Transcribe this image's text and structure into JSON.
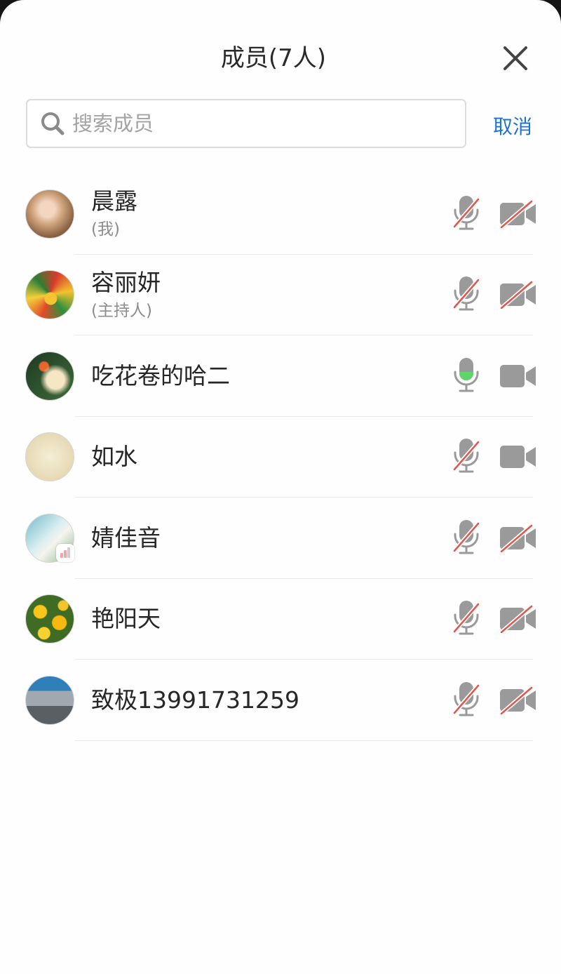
{
  "header": {
    "title": "成员(7人)",
    "close_icon": "close-icon"
  },
  "search": {
    "icon": "search-icon",
    "placeholder": "搜索成员",
    "value": "",
    "cancel_label": "取消"
  },
  "members": [
    {
      "name": "晨露",
      "role": "(我)",
      "mic": "muted",
      "video": "off"
    },
    {
      "name": "容丽妍",
      "role": "(主持人)",
      "mic": "muted",
      "video": "off"
    },
    {
      "name": "吃花卷的哈二",
      "mic": "active",
      "video": "on"
    },
    {
      "name": "如水",
      "mic": "muted",
      "video": "on"
    },
    {
      "name": "婧佳音",
      "mic": "muted",
      "video": "off",
      "status_icon": "signal-strength-icon"
    },
    {
      "name": "艳阳天",
      "mic": "muted",
      "video": "off"
    },
    {
      "name": "致极13991731259",
      "mic": "muted",
      "video": "off"
    }
  ],
  "icons": {
    "mic": "microphone-icon",
    "camera": "camera-icon",
    "muted_overlay": "red-slash"
  },
  "colors": {
    "accent": "#1f73cc",
    "muted_slash": "#e0574b",
    "mic_level": "#5fd46b",
    "icon_gray": "#9a9a9a",
    "text": "#262626",
    "secondary_text": "#8c8c8c"
  }
}
